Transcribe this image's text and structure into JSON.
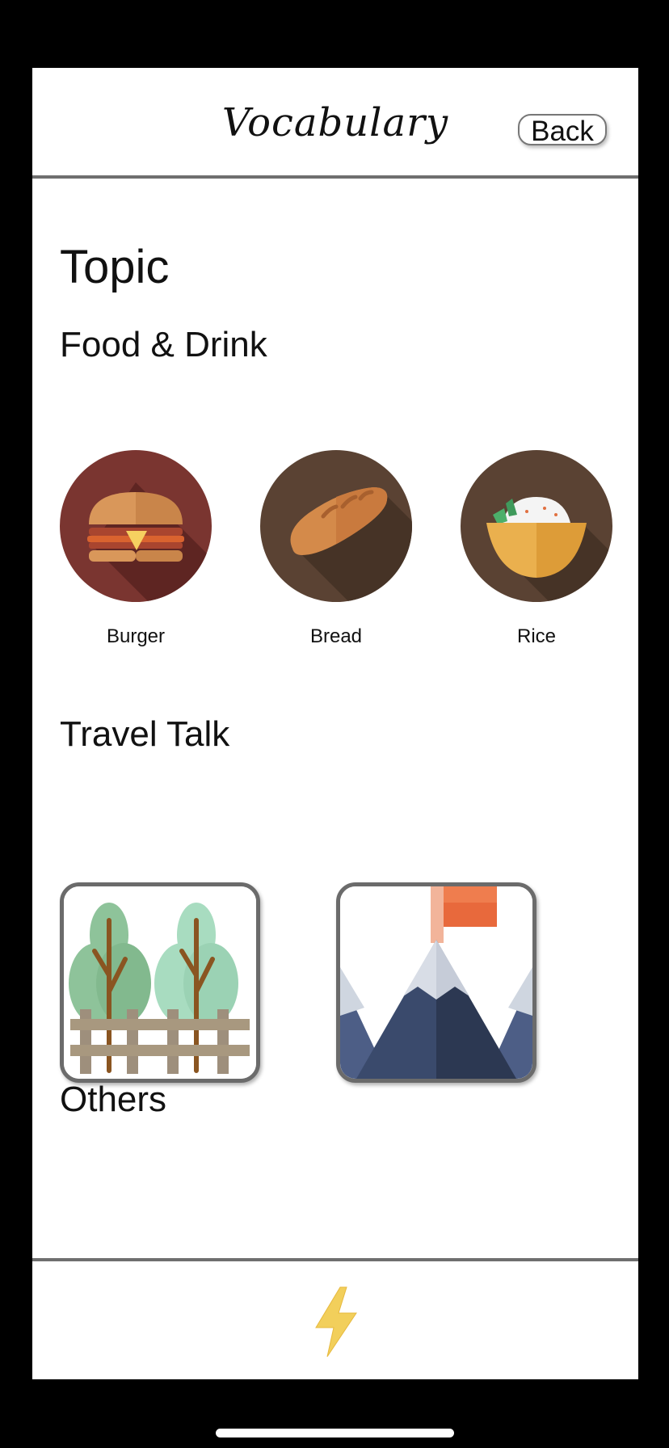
{
  "header": {
    "title": "Vocabulary",
    "back_label": "Back"
  },
  "topic_heading": "Topic",
  "sections": {
    "food": {
      "title": "Food & Drink",
      "items": [
        {
          "label": "Burger",
          "icon": "burger-icon"
        },
        {
          "label": "Bread",
          "icon": "bread-icon"
        },
        {
          "label": "Rice",
          "icon": "rice-bowl-icon"
        }
      ]
    },
    "travel": {
      "title": "Travel Talk",
      "items": [
        {
          "icon": "trees-fence-icon"
        },
        {
          "icon": "mountain-flag-icon"
        }
      ]
    },
    "others": {
      "title": "Others"
    }
  },
  "footer": {
    "icon": "lightning-icon"
  },
  "colors": {
    "background": "#000000",
    "screen": "#ffffff",
    "divider": "#6f6f6f",
    "lightning": "#f2cf5b"
  }
}
